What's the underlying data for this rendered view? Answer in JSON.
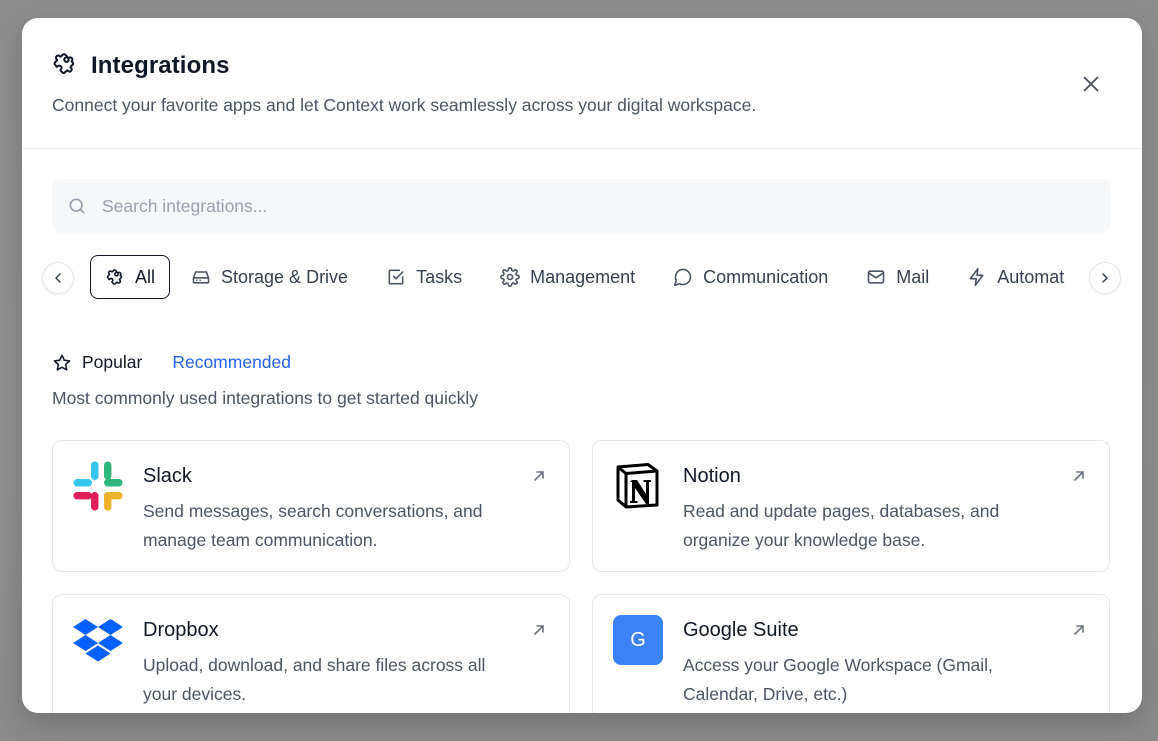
{
  "modal": {
    "title": "Integrations",
    "subtitle": "Connect your favorite apps and let Context work seamlessly across your digital workspace."
  },
  "search": {
    "placeholder": "Search integrations..."
  },
  "tabs": [
    {
      "label": "All",
      "icon": "puzzle-icon",
      "active": true
    },
    {
      "label": "Storage & Drive",
      "icon": "hard-drive-icon"
    },
    {
      "label": "Tasks",
      "icon": "checkbox-icon"
    },
    {
      "label": "Management",
      "icon": "gear-icon"
    },
    {
      "label": "Communication",
      "icon": "chat-bubble-icon"
    },
    {
      "label": "Mail",
      "icon": "mail-icon"
    },
    {
      "label": "Automat",
      "icon": "lightning-icon"
    }
  ],
  "section": {
    "popular_label": "Popular",
    "recommended_label": "Recommended",
    "description": "Most commonly used integrations to get started quickly"
  },
  "integrations": [
    {
      "name": "Slack",
      "description": "Send messages, search conversations, and manage team communication.",
      "icon": "slack-logo"
    },
    {
      "name": "Notion",
      "description": "Read and update pages, databases, and organize your knowledge base.",
      "icon": "notion-logo"
    },
    {
      "name": "Dropbox",
      "description": "Upload, download, and share files across all your devices.",
      "icon": "dropbox-logo"
    },
    {
      "name": "Google Suite",
      "description": "Access your Google Workspace (Gmail, Calendar, Drive, etc.)",
      "icon": "google-logo",
      "logo_letter": "G"
    }
  ],
  "colors": {
    "accent_link": "#2563eb",
    "google_tile": "#3b82f6"
  }
}
